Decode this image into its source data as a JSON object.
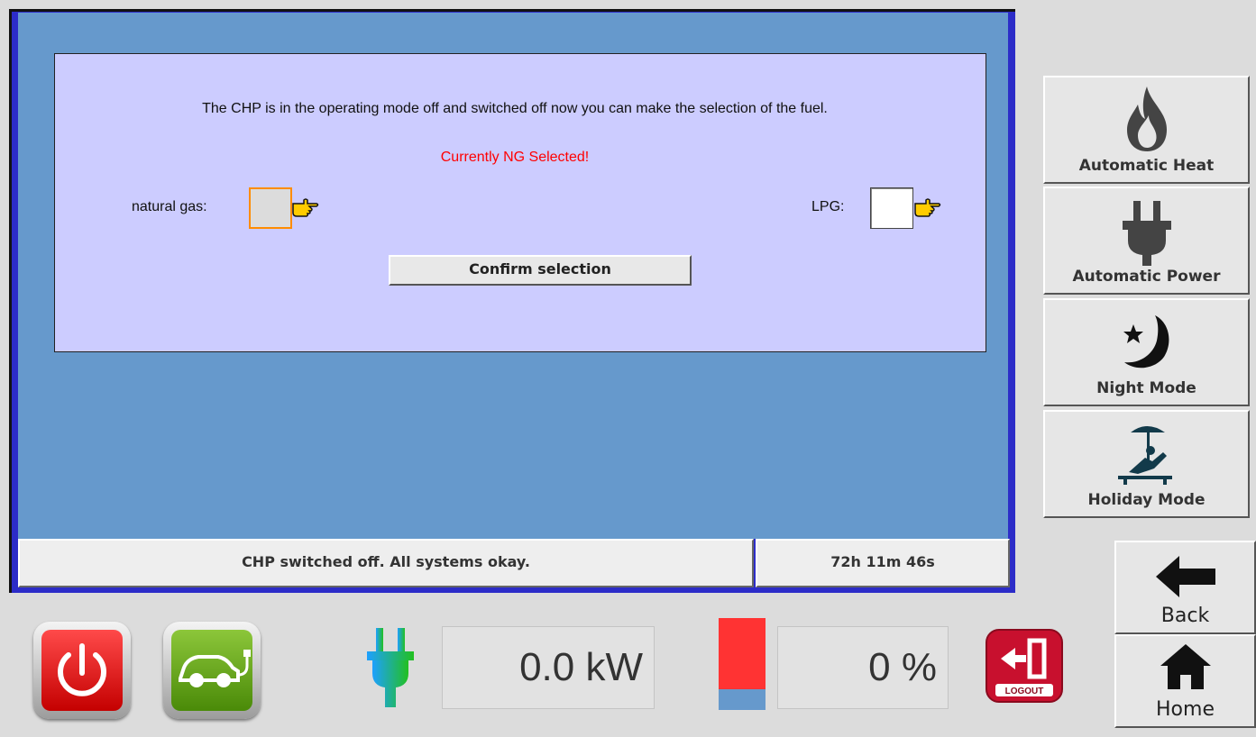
{
  "dialog": {
    "message": "The CHP is in the operating mode off and switched off now you can make the selection of the fuel.",
    "current_selection": "Currently NG Selected!",
    "options": [
      {
        "label": "natural gas:",
        "selected": true
      },
      {
        "label": "LPG:",
        "selected": false
      }
    ],
    "confirm_label": "Confirm selection"
  },
  "status": {
    "message": "CHP switched off. All systems okay.",
    "runtime": "72h 11m 46s"
  },
  "modes": [
    {
      "label": "Automatic Heat",
      "icon": "flame-icon"
    },
    {
      "label": "Automatic Power",
      "icon": "plug-icon"
    },
    {
      "label": "Night Mode",
      "icon": "moon-star-icon"
    },
    {
      "label": "Holiday Mode",
      "icon": "beach-lounger-icon"
    }
  ],
  "nav": {
    "back_label": "Back",
    "home_label": "Home"
  },
  "bottom": {
    "power_value": "0.0 kW",
    "level_value": "0 %",
    "level_fraction": 0.23,
    "logout_label": "LOGOUT"
  },
  "colors": {
    "main_background": "#6699cc",
    "dialog_background": "#ccccff",
    "warning_text": "#ff0000",
    "selected_border": "#ff8c00",
    "power_button": "#e02020",
    "ev_button": "#6aa812"
  }
}
